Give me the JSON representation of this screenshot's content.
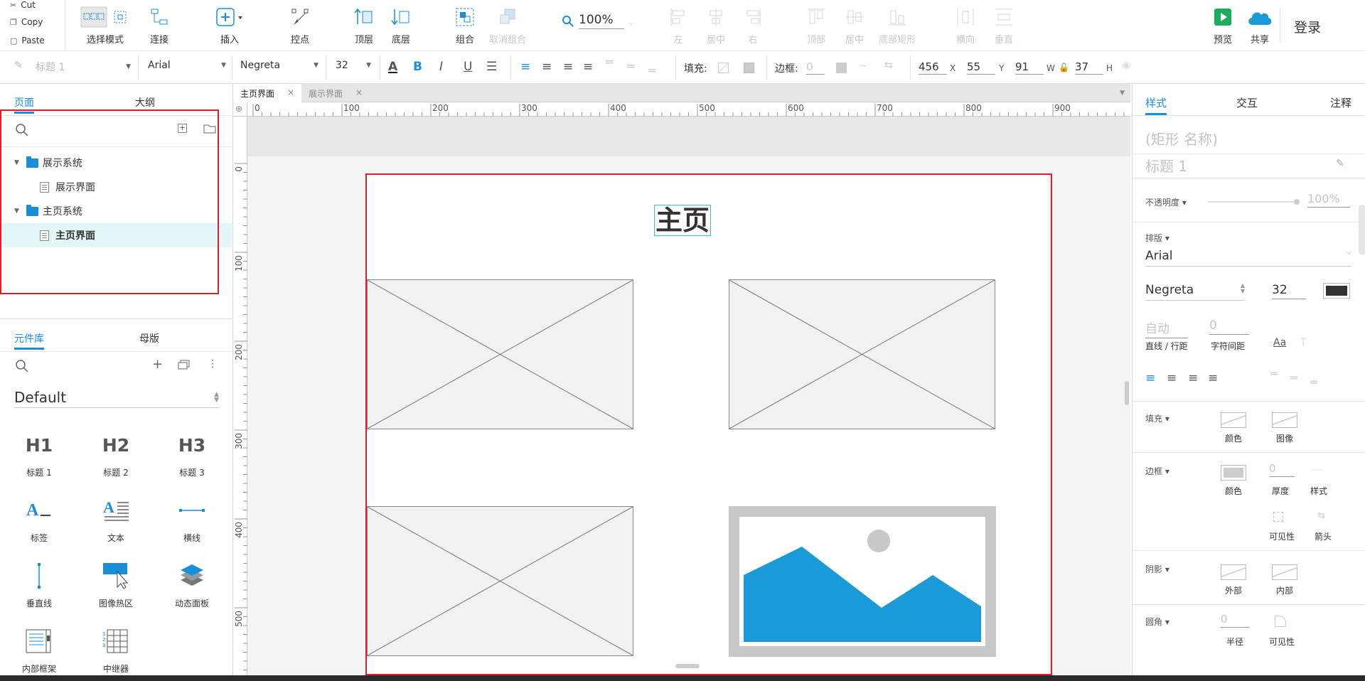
{
  "clipboard": {
    "cut": "Cut",
    "copy": "Copy",
    "paste": "Paste"
  },
  "toolbar": {
    "select_mode": "选择模式",
    "connect": "连接",
    "insert": "插入",
    "point": "控点",
    "top_layer": "顶层",
    "bottom_layer": "底层",
    "group": "组合",
    "ungroup": "取消组合",
    "zoom": "100%",
    "align_left": "左",
    "align_center": "居中",
    "align_right": "右",
    "align_top": "顶部",
    "align_middle": "居中",
    "align_bottom": "底部矩形",
    "distribute_h": "横向",
    "distribute_v": "垂直",
    "preview": "预览",
    "share": "共享",
    "login": "登录"
  },
  "format": {
    "style": "标题 1",
    "font": "Arial",
    "weight": "Negreta",
    "size": "32",
    "fill_label": "填充:",
    "border_label": "边框:",
    "border_value": "0",
    "x": "456",
    "x_label": "X",
    "y": "55",
    "y_label": "Y",
    "w": "91",
    "w_label": "W",
    "h": "37",
    "h_label": "H"
  },
  "left": {
    "tabs": [
      "页面",
      "大纲"
    ],
    "tree": [
      {
        "label": "展示系统",
        "type": "folder"
      },
      {
        "label": "展示界面",
        "type": "page"
      },
      {
        "label": "主页系统",
        "type": "folder"
      },
      {
        "label": "主页界面",
        "type": "page",
        "selected": true
      }
    ],
    "lib_tabs": [
      "元件库",
      "母版"
    ],
    "lib_name": "Default",
    "widgets": [
      {
        "glyph": "H1",
        "label": "标题 1"
      },
      {
        "glyph": "H2",
        "label": "标题 2"
      },
      {
        "glyph": "H3",
        "label": "标题 3"
      },
      {
        "label": "标签"
      },
      {
        "label": "文本"
      },
      {
        "label": "横线"
      },
      {
        "label": "垂直线"
      },
      {
        "label": "图像热区"
      },
      {
        "label": "动态面板"
      },
      {
        "label": "内部框架"
      },
      {
        "label": "中继器"
      }
    ]
  },
  "doc_tabs": [
    {
      "label": "主页界面",
      "active": true
    },
    {
      "label": "展示界面",
      "active": false
    }
  ],
  "ruler": {
    "h_ticks": [
      "0",
      "100",
      "200",
      "300",
      "400",
      "500",
      "600",
      "700",
      "800",
      "900"
    ],
    "v_ticks": [
      "0",
      "100",
      "200",
      "300",
      "400",
      "500"
    ]
  },
  "canvas": {
    "heading": "主页"
  },
  "right": {
    "tabs": [
      "样式",
      "交互",
      "注释"
    ],
    "shape_name_placeholder": "(矩形 名称)",
    "style_name": "标题 1",
    "opacity_label": "不透明度",
    "opacity_value": "100%",
    "typography_label": "排版",
    "font": "Arial",
    "weight": "Negreta",
    "size": "32",
    "line_height_value": "自动",
    "letter_spacing_value": "0",
    "line_height_label": "直线 / 行距",
    "letter_spacing_label": "字符间距",
    "fill_label": "填充",
    "fill_color": "颜色",
    "fill_image": "图像",
    "border_label": "边框",
    "border_color": "颜色",
    "border_thickness_value": "0",
    "border_thickness": "厚度",
    "border_style": "样式",
    "border_visibility": "可见性",
    "border_arrow": "箭头",
    "shadow_label": "阴影",
    "shadow_outer": "外部",
    "shadow_inner": "内部",
    "radius_label": "圆角",
    "radius_value": "0",
    "radius": "半径",
    "radius_visibility": "可见性"
  },
  "colors": {
    "accent": "#1a8ed8",
    "selection_red": "#e01e2b",
    "selected_row": "#e3f6f8",
    "image_blue": "#1a9ad6",
    "preview_green": "#1aab5b"
  }
}
